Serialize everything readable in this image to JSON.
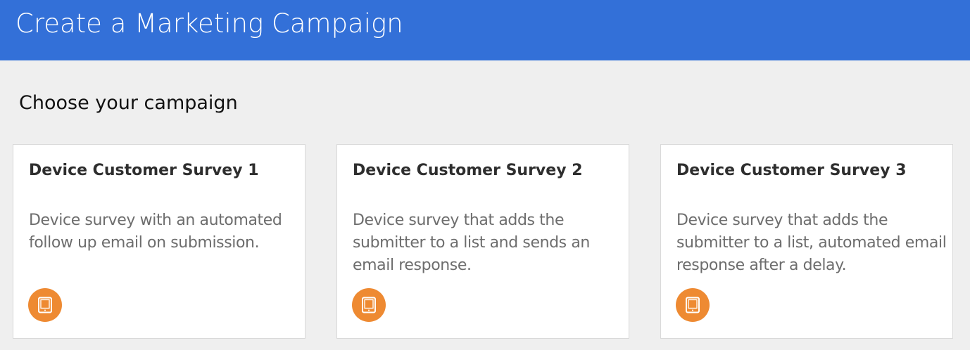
{
  "header": {
    "title": "Create a Marketing Campaign",
    "color": "#3370d8"
  },
  "main": {
    "section_title": "Choose your campaign",
    "campaigns": [
      {
        "title": "Device Customer Survey 1",
        "description": "Device survey with an automated follow up email on submission.",
        "icon": "tablet-icon",
        "icon_color": "#ee8a32"
      },
      {
        "title": "Device Customer Survey 2",
        "description": "Device survey that adds the submitter to a list and sends an email response.",
        "icon": "tablet-icon",
        "icon_color": "#ee8a32"
      },
      {
        "title": "Device Customer Survey 3",
        "description": "Device survey that adds the submitter to a list, automated email response after a delay.",
        "icon": "tablet-icon",
        "icon_color": "#ee8a32"
      }
    ]
  }
}
